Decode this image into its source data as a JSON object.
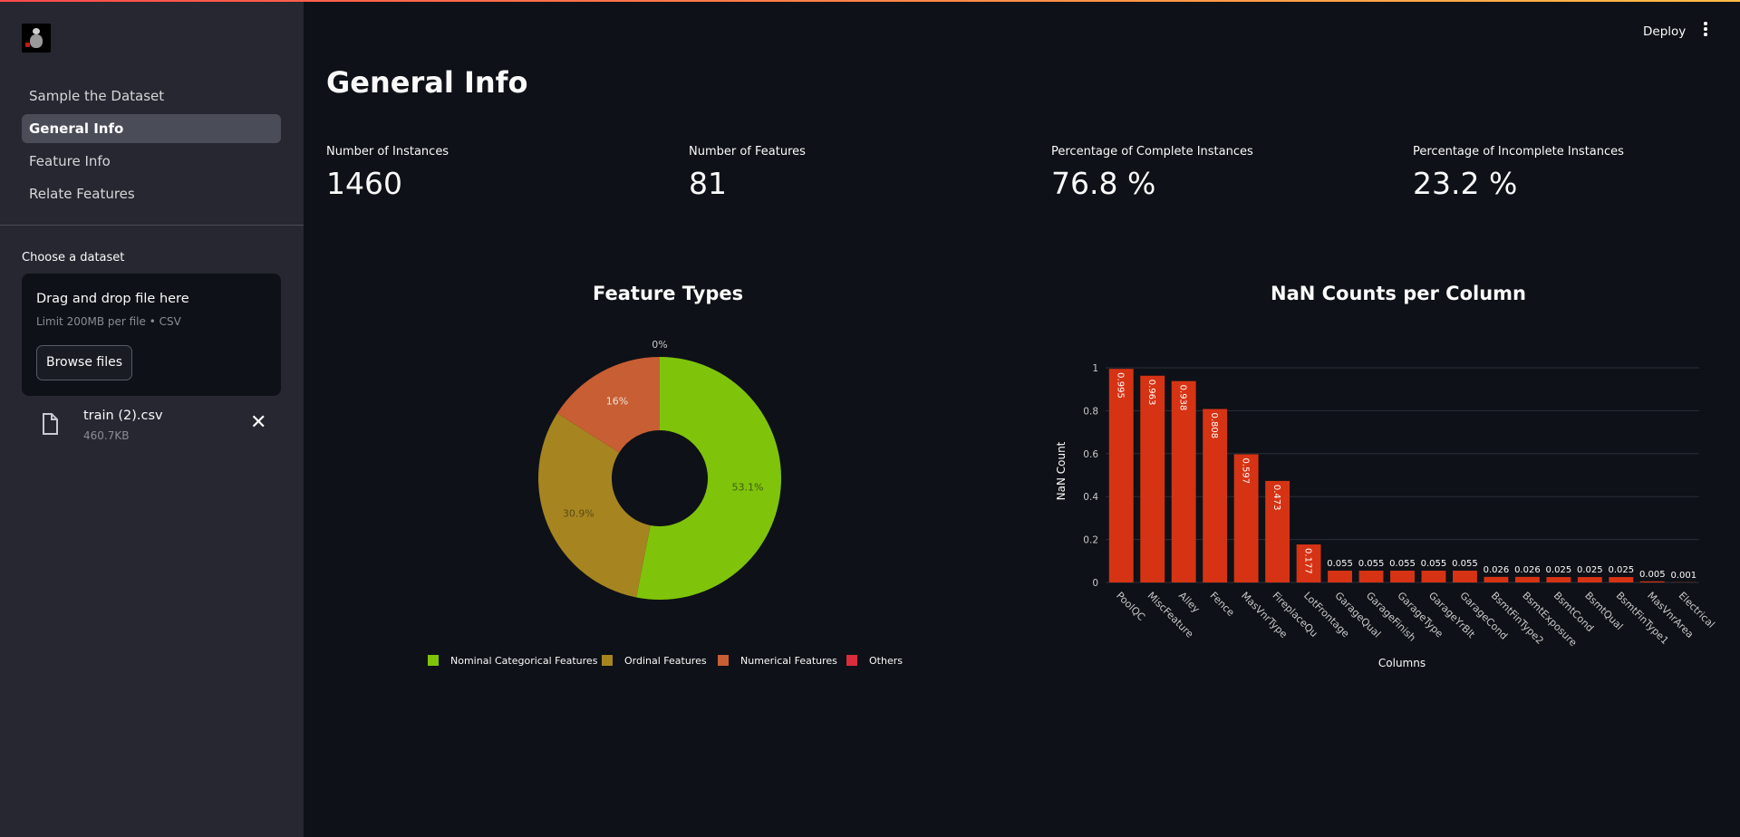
{
  "header": {
    "deploy_label": "Deploy"
  },
  "sidebar": {
    "nav": [
      "Sample the Dataset",
      "General Info",
      "Feature Info",
      "Relate Features"
    ],
    "active_index": 1,
    "uploader": {
      "label": "Choose a dataset",
      "drop_text": "Drag and drop file here",
      "limit_text": "Limit 200MB per file • CSV",
      "browse_label": "Browse files"
    },
    "file": {
      "name": "train (2).csv",
      "size": "460.7KB"
    }
  },
  "main": {
    "title": "General Info",
    "metrics": [
      {
        "label": "Number of Instances",
        "value": "1460"
      },
      {
        "label": "Number of Features",
        "value": "81"
      },
      {
        "label": "Percentage of Complete Instances",
        "value": "76.8 %"
      },
      {
        "label": "Percentage of Incomplete Instances",
        "value": "23.2 %"
      }
    ]
  },
  "chart_data": [
    {
      "type": "pie",
      "title": "Feature Types",
      "hole": true,
      "labels": [
        "Nominal Categorical Features",
        "Ordinal Features",
        "Numerical Features",
        "Others"
      ],
      "values": [
        53.1,
        30.9,
        16,
        0
      ],
      "value_labels": [
        "53.1%",
        "30.9%",
        "16%",
        "0%"
      ],
      "colors": [
        "#7fc40a",
        "#a68521",
        "#c85e33",
        "#d92d3c"
      ],
      "legend_position": "bottom"
    },
    {
      "type": "bar",
      "title": "NaN Counts per Column",
      "xlabel": "Columns",
      "ylabel": "NaN Count",
      "categories": [
        "PoolQC",
        "MiscFeature",
        "Alley",
        "Fence",
        "MasVnrType",
        "FireplaceQu",
        "LotFrontage",
        "GarageQual",
        "GarageFinish",
        "GarageType",
        "GarageYrBlt",
        "GarageCond",
        "BsmtFinType2",
        "BsmtExposure",
        "BsmtCond",
        "BsmtQual",
        "BsmtFinType1",
        "MasVnrArea",
        "Electrical"
      ],
      "values": [
        0.995,
        0.963,
        0.938,
        0.808,
        0.597,
        0.473,
        0.177,
        0.055,
        0.055,
        0.055,
        0.055,
        0.055,
        0.026,
        0.026,
        0.025,
        0.025,
        0.025,
        0.005,
        0.001
      ],
      "value_labels": [
        "0.995",
        "0.963",
        "0.938",
        "0.808",
        "0.597",
        "0.473",
        "0.177",
        "0.055",
        "0.055",
        "0.055",
        "0.055",
        "0.055",
        "0.026",
        "0.026",
        "0.025",
        "0.025",
        "0.025",
        "0.005",
        "0.001"
      ],
      "yticks": [
        "0",
        "0.2",
        "0.4",
        "0.6",
        "0.8",
        "1"
      ],
      "ylim": [
        0,
        1
      ],
      "bar_color": "#d63314",
      "grid": true
    }
  ]
}
